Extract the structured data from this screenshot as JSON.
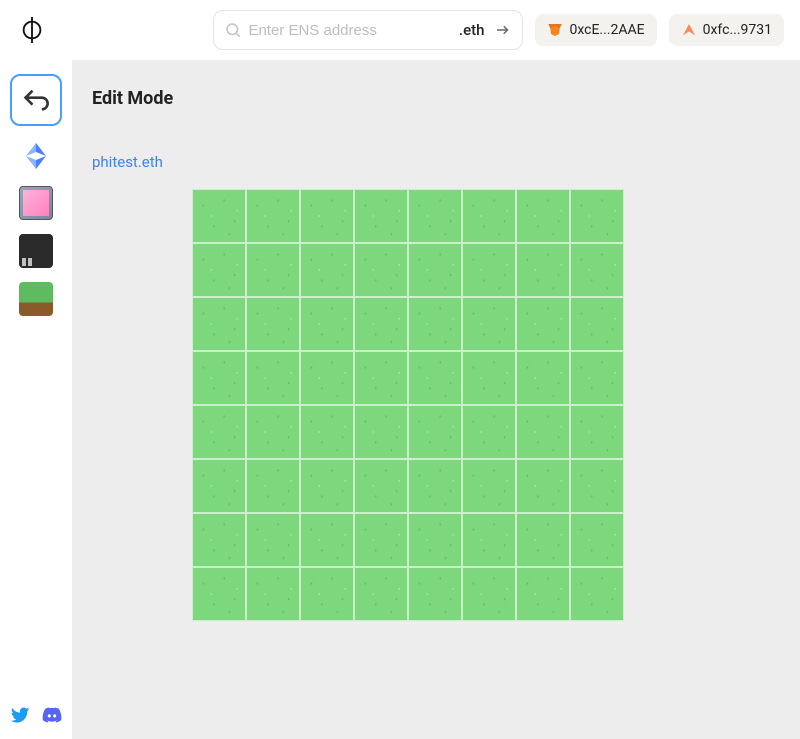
{
  "header": {
    "search_placeholder": "Enter ENS address",
    "search_suffix": ".eth",
    "wallets": [
      {
        "icon": "metamask",
        "label": "0xcE...2AAE"
      },
      {
        "icon": "argent",
        "label": "0xfc...9731"
      }
    ]
  },
  "sidebar": {
    "items": [
      {
        "name": "back",
        "type": "back"
      },
      {
        "name": "ethereum",
        "type": "ring"
      },
      {
        "name": "asset-1",
        "type": "pixel1"
      },
      {
        "name": "asset-2",
        "type": "pixel2"
      },
      {
        "name": "grass",
        "type": "grass"
      }
    ]
  },
  "content": {
    "heading": "Edit Mode",
    "subdomain": "phitest.eth",
    "grid_cols": 8,
    "grid_rows": 8
  }
}
